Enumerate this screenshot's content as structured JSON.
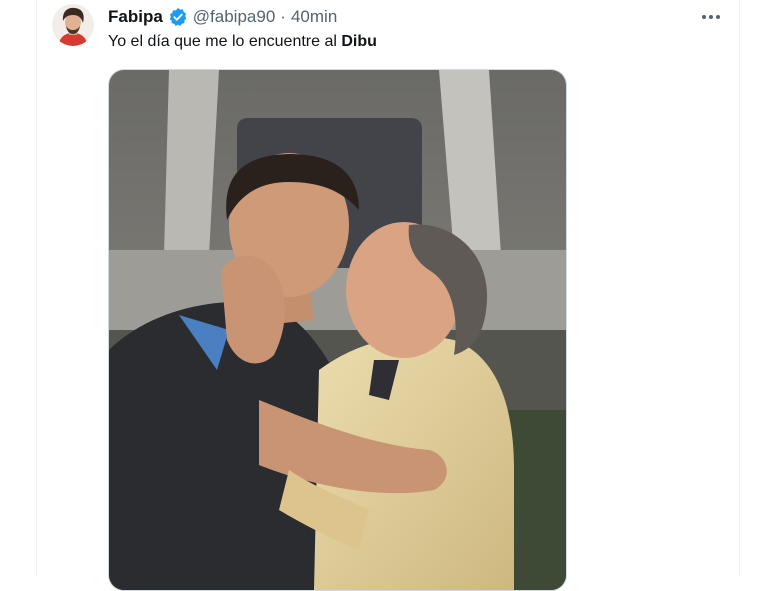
{
  "tweet": {
    "author_name": "Fabipa",
    "handle": "@fabipa90",
    "separator": "·",
    "time": "40min",
    "text_main": "Yo el día que me lo encuentre al ",
    "text_bold": "Dibu"
  },
  "icons": {
    "verified": "verified-badge-icon",
    "more": "more-options-icon"
  },
  "colors": {
    "verified_blue": "#1d9bf0",
    "text_primary": "#0f1419",
    "text_secondary": "#536471"
  }
}
